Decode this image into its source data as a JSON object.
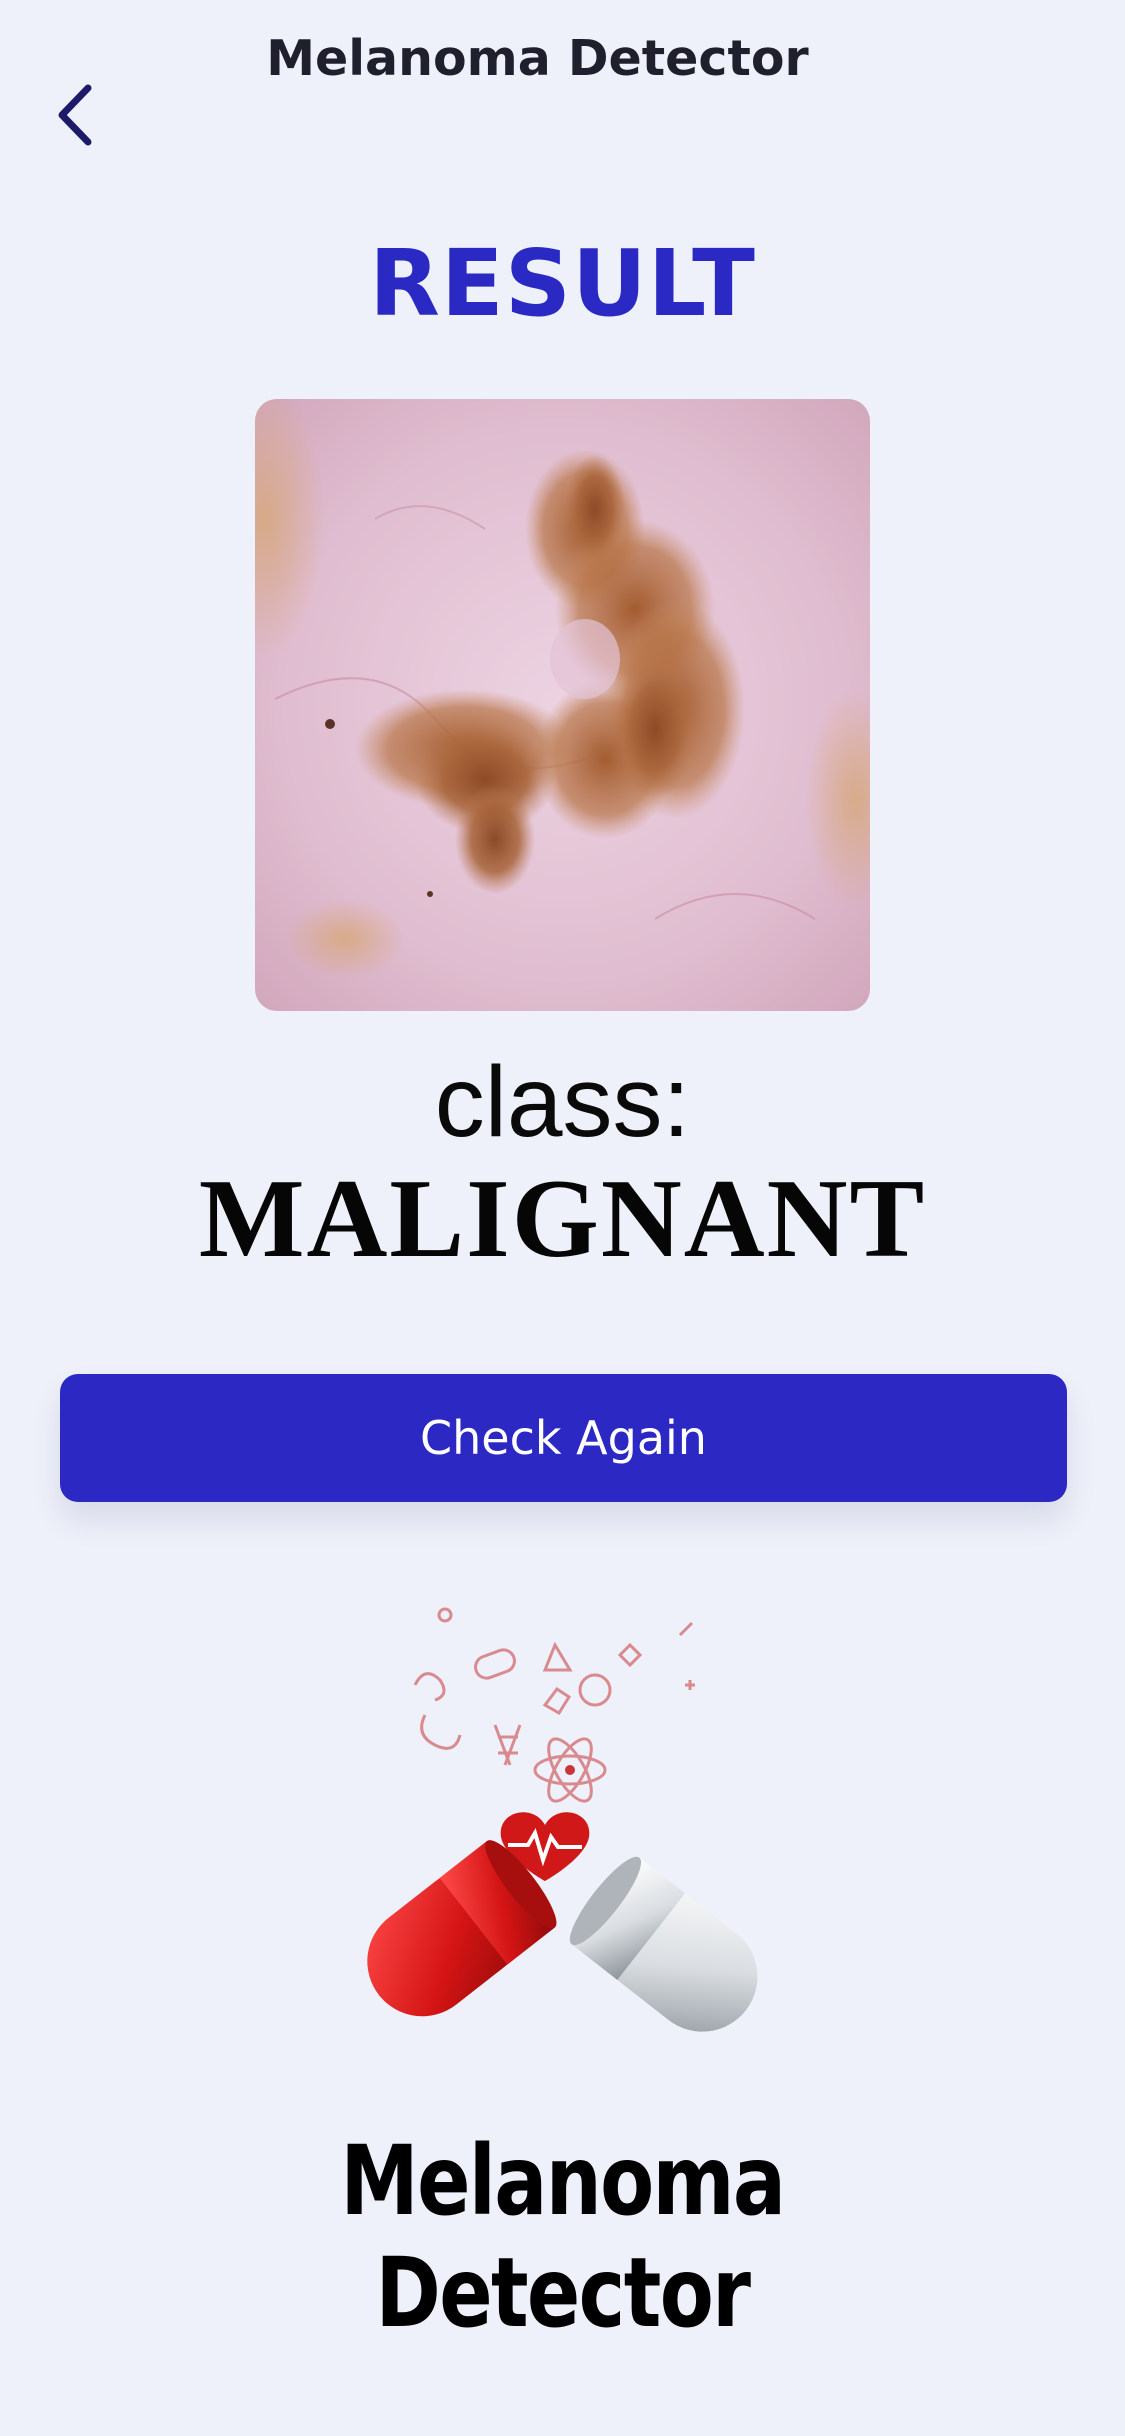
{
  "header": {
    "title": "Melanoma Detector",
    "back_icon": "chevron-left-icon"
  },
  "result": {
    "heading": "RESULT",
    "class_label": "class:",
    "class_value": "MALIGNANT",
    "image_description_icon": "skin-lesion-photo"
  },
  "actions": {
    "check_again_label": "Check Again"
  },
  "logo": {
    "icon": "open-capsule-medical-icon",
    "line1": "Melanoma",
    "line2": "Detector"
  },
  "colors": {
    "background": "#eef1f9",
    "accent": "#2c28c4",
    "heading": "#2b29c4",
    "capsule_red": "#d81b1b",
    "capsule_white": "#e6e9ec"
  }
}
